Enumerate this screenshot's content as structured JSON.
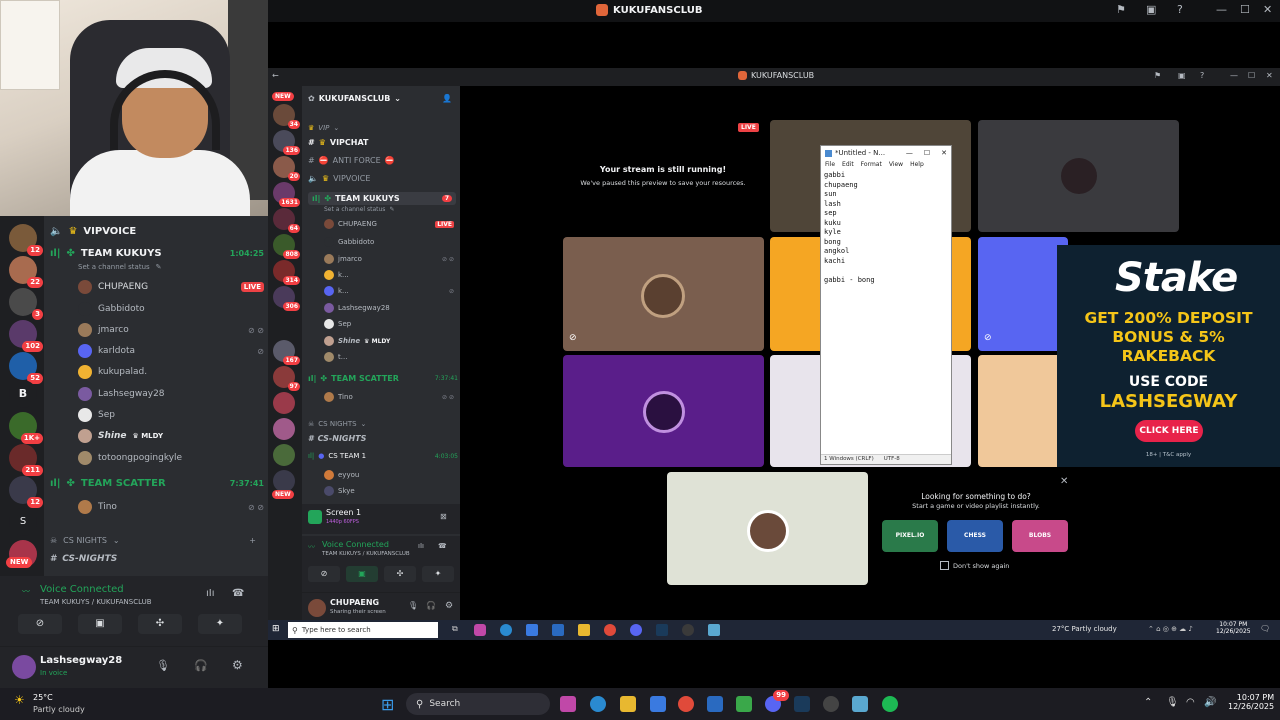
{
  "top_title": "KUKUFANSCLUB",
  "inner_title": "KUKUFANSCLUB",
  "left": {
    "server_badges": [
      "12",
      "22",
      "3",
      "102",
      "52",
      "",
      "1K+",
      "211",
      "12",
      "",
      ""
    ],
    "server_letters": [
      "B",
      "S"
    ],
    "new_label": "NEW",
    "channels": {
      "vipvoice": "VIPVOICE",
      "team_kukuys": "TEAM KUKUYS",
      "team_kukuys_time": "1:04:25",
      "set_status": "Set a channel status",
      "team_scatter": "TEAM SCATTER",
      "team_scatter_time": "7:37:41",
      "cs_nights_cat": "CS NIGHTS",
      "cs_nights": "CS-NIGHTS"
    },
    "users": [
      {
        "name": "CHUPAENG",
        "live": "LIVE"
      },
      {
        "name": "Gabbidoto"
      },
      {
        "name": "jmarco"
      },
      {
        "name": "karldota"
      },
      {
        "name": "kukupalad."
      },
      {
        "name": "Lashsegway28"
      },
      {
        "name": "Sep"
      },
      {
        "name": "Shine",
        "tag": "MLDY"
      },
      {
        "name": "totoongpogingkyle"
      }
    ],
    "scatter_user": "Tino",
    "voice_connected": "Voice Connected",
    "voice_location": "TEAM KUKUYS / KUKUFANSCLUB",
    "me_name": "Lashsegway28",
    "me_status": "In voice"
  },
  "inner": {
    "rail_badges": [
      "34",
      "136",
      "20",
      "1631",
      "64",
      "808",
      "314",
      "306",
      "167",
      "97"
    ],
    "rail_new": "NEW",
    "server_name": "KUKUFANSCLUB",
    "vip_cat": "VIP",
    "vipchat": "VIPCHAT",
    "anti_force": "ANTI FORCE",
    "vipvoice": "VIPVOICE",
    "team_kukuys": "TEAM KUKUYS",
    "team_kukuys_badge": "7",
    "set_status": "Set a channel status",
    "users": [
      {
        "name": "CHUPAENG",
        "live": "LIVE"
      },
      {
        "name": "Gabbidoto"
      },
      {
        "name": "jmarco"
      },
      {
        "name": "k..."
      },
      {
        "name": "k..."
      },
      {
        "name": "Lashsegway28"
      },
      {
        "name": "Sep"
      },
      {
        "name": "Shine",
        "tag": "MLDY"
      },
      {
        "name": "t..."
      }
    ],
    "team_scatter": "TEAM SCATTER",
    "team_scatter_time": "7:37:41",
    "scatter_user": "Tino",
    "cs_nights_cat": "CS NIGHTS",
    "cs_nights": "CS-NIGHTS",
    "cs_team1": "CS TEAM 1",
    "cs_team1_time": "4:03:05",
    "cs_users": [
      "eyyou",
      "Skye"
    ],
    "screen_label": "Screen 1",
    "screen_sub": "1440p 60FPS",
    "voice_connected": "Voice Connected",
    "voice_location": "TEAM KUKUYS / KUKUFANSCLUB",
    "me_name": "CHUPAENG",
    "me_status": "Sharing their screen"
  },
  "stream": {
    "live_badge": "LIVE",
    "still_running": "Your stream is still running!",
    "paused_msg": "We've paused this preview to save your resources.",
    "looking_title": "Looking for something to do?",
    "looking_sub": "Start a game or video playlist instantly.",
    "dont_show": "Don't show again",
    "game_labels": [
      "PIXEL.IO",
      "CHESS",
      "BLOBS"
    ]
  },
  "notepad": {
    "title": "*Untitled - N...",
    "menu": [
      "File",
      "Edit",
      "Format",
      "View",
      "Help"
    ],
    "text": "gabbi\nchupaeng\nsun\nlash\nsep\nkuku\nkyle\nbong\nangkol\nkachi\n\ngabbi - bong",
    "status_pos": "1  Windows (CRLF)",
    "status_enc": "UTF-8"
  },
  "ad": {
    "brand": "Stake",
    "line1": "GET 200% DEPOSIT",
    "line2": "BONUS & 5%",
    "line3": "RAKEBACK",
    "use_code": "USE CODE",
    "code": "LASHSEGWAY",
    "cta": "CLICK HERE",
    "fine": "18+ | T&C apply"
  },
  "inner_taskbar": {
    "search_placeholder": "Type here to search",
    "weather": "27°C  Partly cloudy",
    "time": "10:07 PM",
    "date": "12/26/2025"
  },
  "taskbar": {
    "temp": "25°C",
    "weather": "Partly cloudy",
    "search": "Search",
    "discord_badge": "99",
    "time": "10:07 PM",
    "date": "12/26/2025"
  },
  "colors": {
    "discord_bg": "#2b2d31",
    "rail_bg": "#1e1f22",
    "green": "#23a55a",
    "live_red": "#ed4245",
    "stake_yellow": "#f5c518",
    "stake_bg": "#0e2130"
  }
}
